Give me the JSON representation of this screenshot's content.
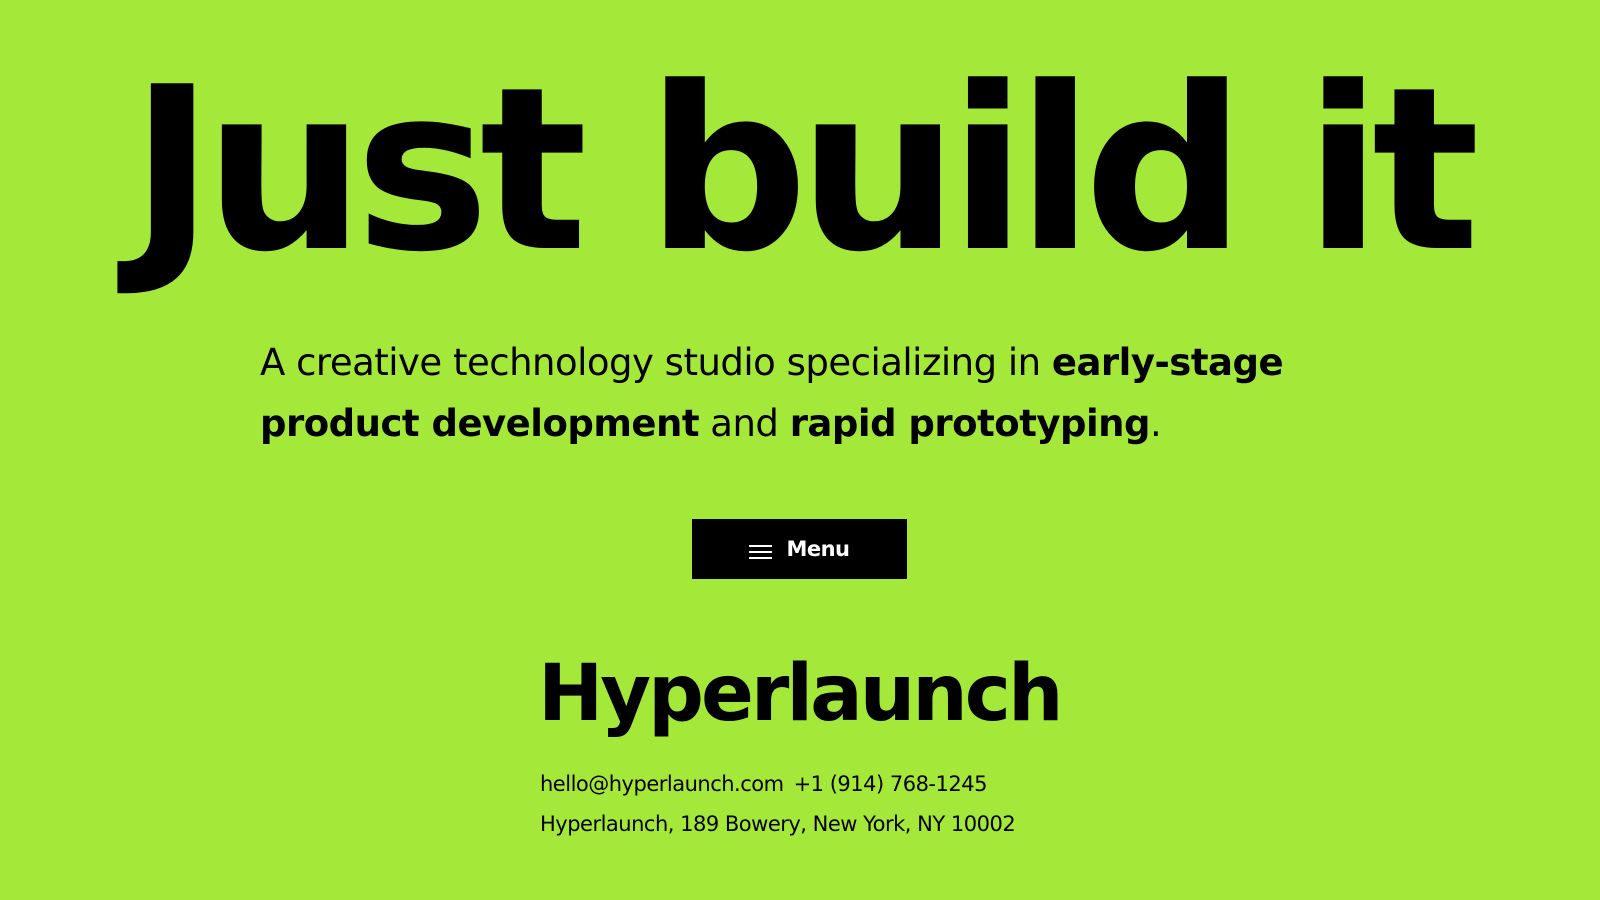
{
  "hero": {
    "title": "Just build it"
  },
  "tagline": {
    "part1": "A creative technology studio specializing in ",
    "highlight1": "early-stage product development",
    "part2": " and ",
    "highlight2": "rapid prototyping",
    "part3": "."
  },
  "menu_button": {
    "label": "Menu",
    "icon": "hamburger-icon"
  },
  "footer": {
    "brand": "Hyperlaunch",
    "email": "hello@hyperlaunch.com",
    "phone": "+1 (914) 768-1245",
    "address": "Hyperlaunch, 189 Bowery, New York, NY 10002"
  },
  "colors": {
    "background": "#a4e83a",
    "text": "#000000",
    "button_bg": "#000000",
    "button_text": "#ffffff"
  }
}
